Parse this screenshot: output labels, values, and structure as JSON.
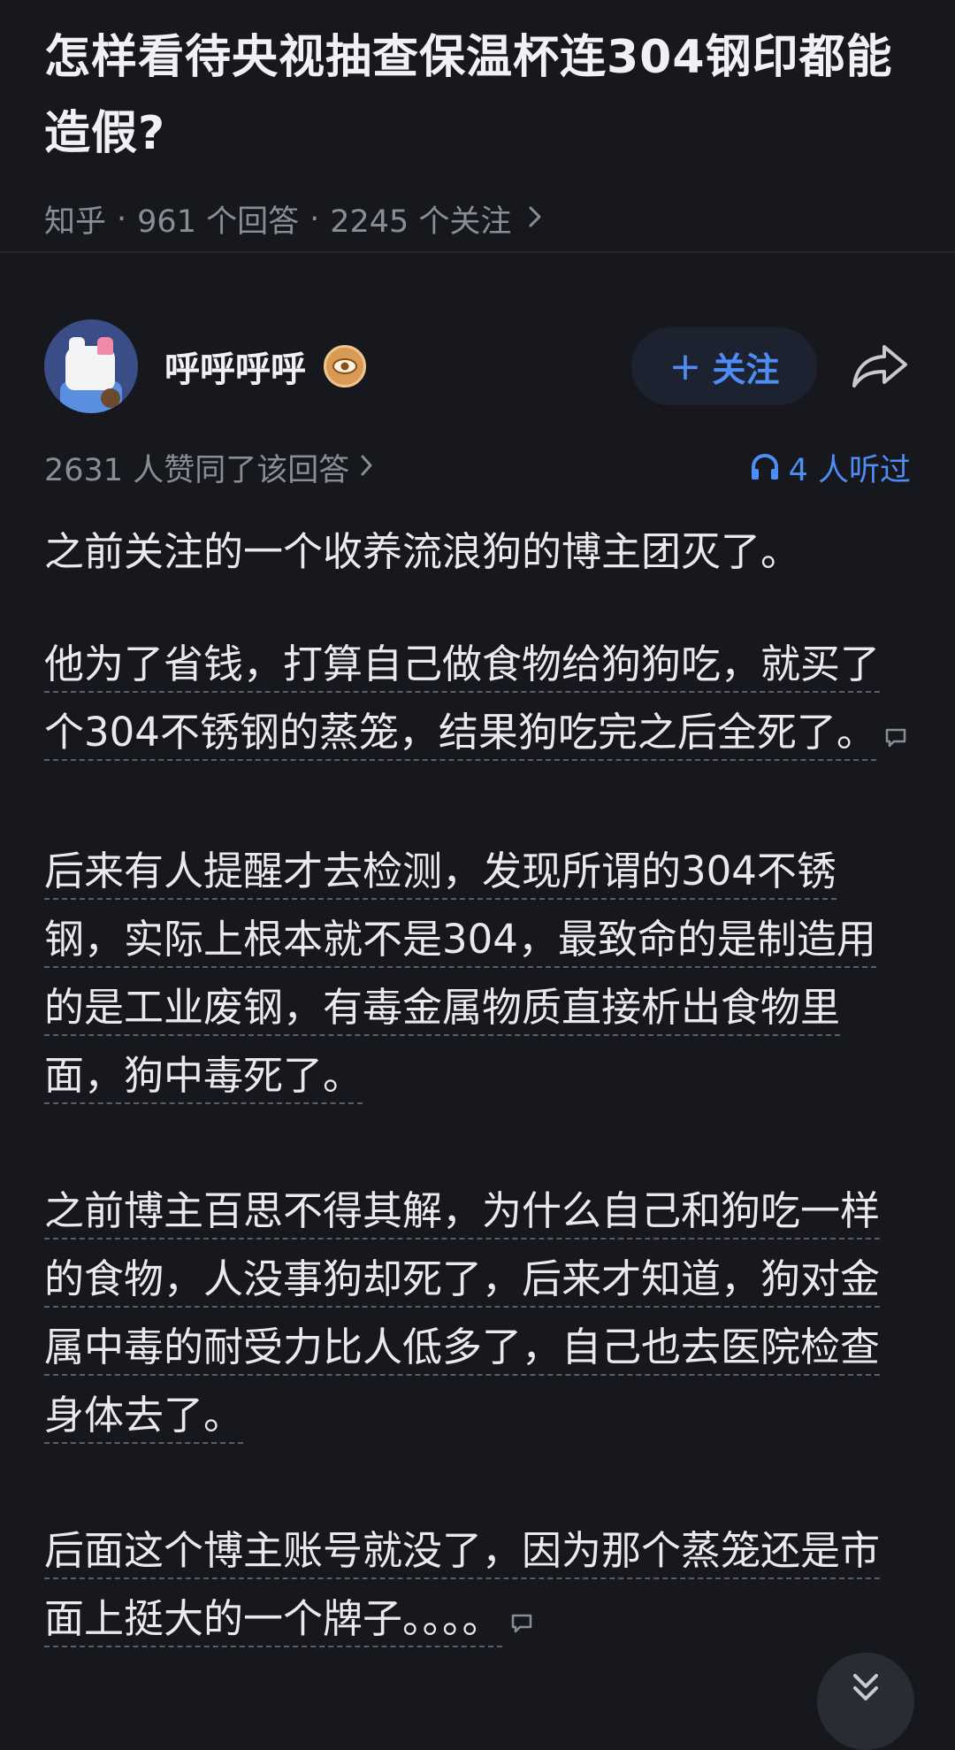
{
  "question": {
    "title": "怎样看待央视抽查保温杯连304钢印都能造假?",
    "source": "知乎",
    "answers_count": "961 个回答",
    "followers_count": "2245 个关注"
  },
  "answer": {
    "author_name": "呼呼呼呼",
    "follow_label": "关注",
    "upvotes_text": "2631 人赞同了该回答",
    "listen_text": "4 人听过",
    "paragraphs": [
      "之前关注的一个收养流浪狗的博主团灭了。",
      "他为了省钱，打算自己做食物给狗狗吃，就买了个304不锈钢的蒸笼，结果狗吃完之后全死了。",
      "后来有人提醒才去检测，发现所谓的304不锈钢，实际上根本就不是304，最致命的是制造用的是工业废钢，有毒金属物质直接析出食物里面，狗中毒死了。",
      "之前博主百思不得其解，为什么自己和狗吃一样的食物，人没事狗却死了，后来才知道，狗对金属中毒的耐受力比人低多了，自己也去医院检查身体去了。",
      "后面这个博主账号就没了，因为那个蒸笼还是市面上挺大的一个牌子。。。。"
    ]
  },
  "colors": {
    "background": "#17181d",
    "accent_blue": "#4e8df5",
    "muted_text": "#8b8d95"
  },
  "icons": {
    "meta_chevron": "chevron-right-icon",
    "badge": "eye-badge-icon",
    "share": "share-arrow-icon",
    "listen": "headphones-icon",
    "comment": "comment-bubble-icon",
    "scroll": "double-chevron-down-icon"
  }
}
